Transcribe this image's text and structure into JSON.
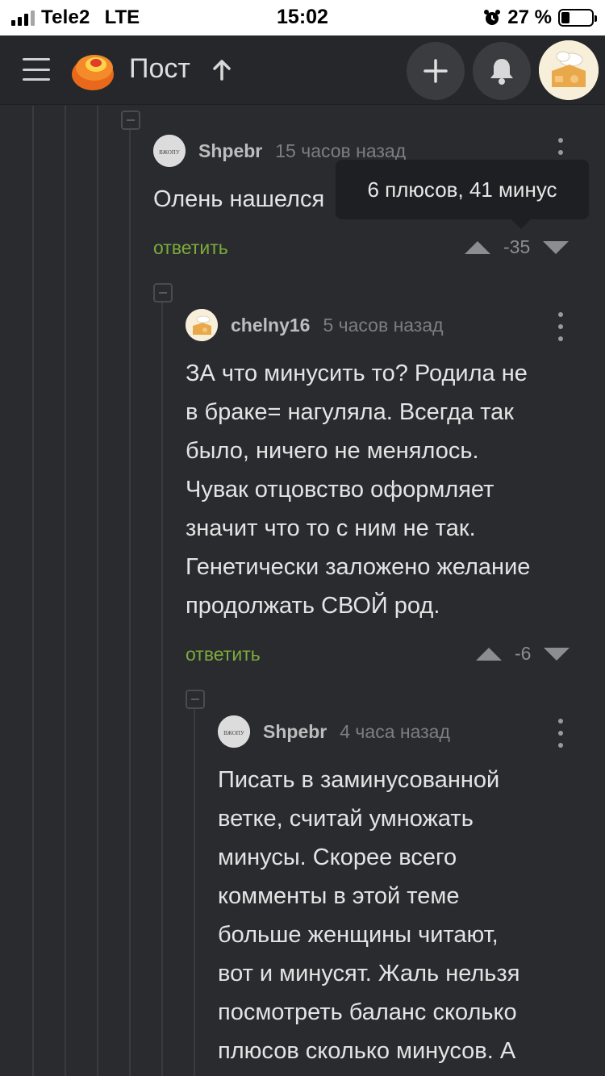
{
  "status_bar": {
    "carrier": "Tele2",
    "network": "LTE",
    "time": "15:02",
    "battery": "27 %",
    "battery_level": 0.27
  },
  "header": {
    "title": "Пост",
    "icons": [
      "menu-icon",
      "pikabu-logo",
      "arrow-up-icon",
      "plus-icon",
      "bell-icon",
      "avatar"
    ]
  },
  "tooltip": {
    "text": "6 плюсов, 41 минус"
  },
  "comments": [
    {
      "author": "Shpebr",
      "time": "15 часов назад",
      "avatar_text": "ВЖОПУ",
      "body": "Олень нашелся",
      "reply_label": "ответить",
      "rating": "-35"
    },
    {
      "author": "chelny16",
      "time": "5 часов назад",
      "body_lines": [
        "ЗА что минусить то? Родила не",
        "в браке= нагуляла. Всегда так",
        "было, ничего не менялось.",
        "Чувак отцовство оформляет",
        "значит что то с ним не так.",
        "Генетически заложено желание",
        "продолжать СВОЙ род."
      ],
      "reply_label": "ответить",
      "rating": "-6"
    },
    {
      "author": "Shpebr",
      "time": "4 часа назад",
      "avatar_text": "ВЖОПУ",
      "body_lines": [
        "Писать в заминусованной",
        "ветке, считай умножать",
        "минусы. Скорее всего",
        "комменты в этой теме",
        "больше женщины читают,",
        "вот и минусят. Жаль нельзя",
        "посмотреть баланс сколько",
        "плюсов сколько минусов. А"
      ]
    }
  ]
}
